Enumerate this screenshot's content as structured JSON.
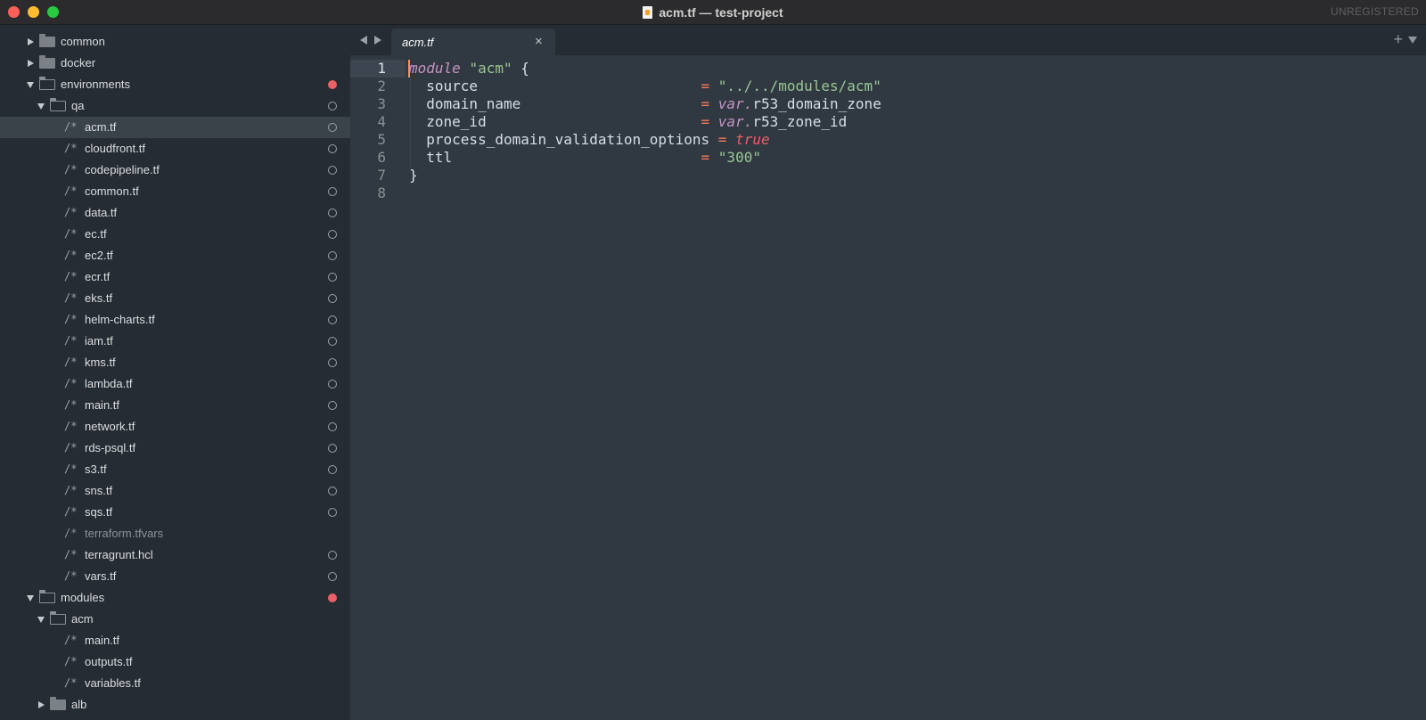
{
  "window": {
    "title": "acm.tf — test-project",
    "license_status": "UNREGISTERED"
  },
  "sidebar": {
    "rows": [
      {
        "name": "common",
        "kind": "folder",
        "state": "collapsed",
        "depth": 1
      },
      {
        "name": "docker",
        "kind": "folder",
        "state": "collapsed",
        "depth": 1
      },
      {
        "name": "environments",
        "kind": "folder",
        "state": "expanded",
        "depth": 1,
        "status": "modified"
      },
      {
        "name": "qa",
        "kind": "folder",
        "state": "expanded",
        "depth": 2,
        "status": "untracked"
      },
      {
        "name": "acm.tf",
        "kind": "file",
        "depth": 3,
        "status": "untracked",
        "selected": true
      },
      {
        "name": "cloudfront.tf",
        "kind": "file",
        "depth": 3,
        "status": "untracked"
      },
      {
        "name": "codepipeline.tf",
        "kind": "file",
        "depth": 3,
        "status": "untracked"
      },
      {
        "name": "common.tf",
        "kind": "file",
        "depth": 3,
        "status": "untracked"
      },
      {
        "name": "data.tf",
        "kind": "file",
        "depth": 3,
        "status": "untracked"
      },
      {
        "name": "ec.tf",
        "kind": "file",
        "depth": 3,
        "status": "untracked"
      },
      {
        "name": "ec2.tf",
        "kind": "file",
        "depth": 3,
        "status": "untracked"
      },
      {
        "name": "ecr.tf",
        "kind": "file",
        "depth": 3,
        "status": "untracked"
      },
      {
        "name": "eks.tf",
        "kind": "file",
        "depth": 3,
        "status": "untracked"
      },
      {
        "name": "helm-charts.tf",
        "kind": "file",
        "depth": 3,
        "status": "untracked"
      },
      {
        "name": "iam.tf",
        "kind": "file",
        "depth": 3,
        "status": "untracked"
      },
      {
        "name": "kms.tf",
        "kind": "file",
        "depth": 3,
        "status": "untracked"
      },
      {
        "name": "lambda.tf",
        "kind": "file",
        "depth": 3,
        "status": "untracked"
      },
      {
        "name": "main.tf",
        "kind": "file",
        "depth": 3,
        "status": "untracked"
      },
      {
        "name": "network.tf",
        "kind": "file",
        "depth": 3,
        "status": "untracked"
      },
      {
        "name": "rds-psql.tf",
        "kind": "file",
        "depth": 3,
        "status": "untracked"
      },
      {
        "name": "s3.tf",
        "kind": "file",
        "depth": 3,
        "status": "untracked"
      },
      {
        "name": "sns.tf",
        "kind": "file",
        "depth": 3,
        "status": "untracked"
      },
      {
        "name": "sqs.tf",
        "kind": "file",
        "depth": 3,
        "status": "untracked"
      },
      {
        "name": "terraform.tfvars",
        "kind": "file",
        "depth": 3,
        "dim": true
      },
      {
        "name": "terragrunt.hcl",
        "kind": "file",
        "depth": 3,
        "status": "untracked"
      },
      {
        "name": "vars.tf",
        "kind": "file",
        "depth": 3,
        "status": "untracked"
      },
      {
        "name": "modules",
        "kind": "folder",
        "state": "expanded",
        "depth": 1,
        "status": "modified"
      },
      {
        "name": "acm",
        "kind": "folder",
        "state": "expanded",
        "depth": 2
      },
      {
        "name": "main.tf",
        "kind": "file",
        "depth": 3
      },
      {
        "name": "outputs.tf",
        "kind": "file",
        "depth": 3
      },
      {
        "name": "variables.tf",
        "kind": "file",
        "depth": 3
      },
      {
        "name": "alb",
        "kind": "folder",
        "state": "collapsed",
        "depth": 2
      }
    ],
    "file_glyph": "/*"
  },
  "tabs": [
    {
      "label": "acm.tf",
      "active": true
    }
  ],
  "tab_controls": {
    "close_glyph": "×",
    "new_tab_glyph": "+"
  },
  "editor": {
    "active_line": 1,
    "lines": [
      {
        "number": "1",
        "tokens": [
          {
            "t": "module",
            "c": "kw"
          },
          {
            "t": " ",
            "c": "punct"
          },
          {
            "t": "\"acm\"",
            "c": "str"
          },
          {
            "t": " {",
            "c": "punct"
          }
        ]
      },
      {
        "number": "2",
        "tokens": [
          {
            "t": "  source                          ",
            "c": "punct"
          },
          {
            "t": "=",
            "c": "op"
          },
          {
            "t": " ",
            "c": "punct"
          },
          {
            "t": "\"../../modules/acm\"",
            "c": "str"
          }
        ]
      },
      {
        "number": "3",
        "tokens": [
          {
            "t": "  domain_name                     ",
            "c": "punct"
          },
          {
            "t": "=",
            "c": "op"
          },
          {
            "t": " ",
            "c": "punct"
          },
          {
            "t": "var.",
            "c": "var"
          },
          {
            "t": "r53_domain_zone",
            "c": "punct"
          }
        ]
      },
      {
        "number": "4",
        "tokens": [
          {
            "t": "  zone_id                         ",
            "c": "punct"
          },
          {
            "t": "=",
            "c": "op"
          },
          {
            "t": " ",
            "c": "punct"
          },
          {
            "t": "var.",
            "c": "var"
          },
          {
            "t": "r53_zone_id",
            "c": "punct"
          }
        ]
      },
      {
        "number": "5",
        "tokens": [
          {
            "t": "  process_domain_validation_options ",
            "c": "punct"
          },
          {
            "t": "=",
            "c": "op"
          },
          {
            "t": " ",
            "c": "punct"
          },
          {
            "t": "true",
            "c": "bool"
          }
        ]
      },
      {
        "number": "6",
        "tokens": [
          {
            "t": "  ttl                             ",
            "c": "punct"
          },
          {
            "t": "=",
            "c": "op"
          },
          {
            "t": " ",
            "c": "punct"
          },
          {
            "t": "\"300\"",
            "c": "str"
          }
        ]
      },
      {
        "number": "7",
        "tokens": [
          {
            "t": "}",
            "c": "punct"
          }
        ]
      },
      {
        "number": "8",
        "tokens": []
      }
    ]
  },
  "colors": {
    "background": "#303841",
    "sidebar": "#262c33",
    "keyword": "#c594c5",
    "string": "#99c794",
    "operator": "#f97b58",
    "boolean": "#ec5f66",
    "modified_dot": "#ec5f66"
  }
}
